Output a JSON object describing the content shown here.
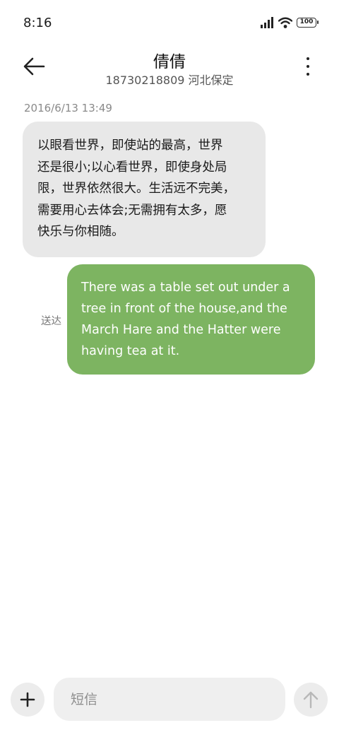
{
  "status_bar": {
    "time": "8:16",
    "battery": "100",
    "icons": [
      "signal-icon",
      "wifi-icon",
      "battery-icon"
    ]
  },
  "header": {
    "contact_name": "倩倩",
    "contact_sub": "18730218809 河北保定",
    "icons": [
      "back-arrow-icon",
      "more-vertical-icon"
    ]
  },
  "messages": [
    {
      "direction": "incoming",
      "date": "2016/6/13 13:49",
      "lines": [
        "以眼看世界，即使站的最高，世界",
        "还是很小;以心看世界，即使身处局",
        "限，世界依然很大。生活远不完美，",
        "需要用心去体会;无需拥有太多，愿",
        "快乐与你相随。"
      ]
    },
    {
      "direction": "outgoing",
      "status": "送达",
      "lines": [
        "There was a table set out under a",
        "tree in front of the house,and the",
        "March Hare and the Hatter were",
        "having tea at it."
      ]
    }
  ],
  "composer": {
    "placeholder": "短信",
    "value": "",
    "icons": [
      "plus-icon",
      "send-arrow-icon"
    ]
  },
  "colors": {
    "incoming_bubble": "#e8e8e8",
    "outgoing_bubble": "#7db461",
    "background": "#ffffff"
  }
}
